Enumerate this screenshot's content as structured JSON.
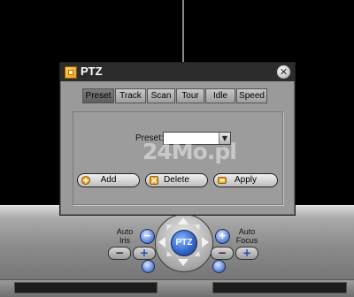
{
  "window": {
    "title": "PTZ",
    "close_icon": "close-icon",
    "icon": "ptz-app-icon"
  },
  "tabs": [
    {
      "label": "Preset",
      "active": true
    },
    {
      "label": "Track",
      "active": false
    },
    {
      "label": "Scan",
      "active": false
    },
    {
      "label": "Tour",
      "active": false
    },
    {
      "label": "Idle",
      "active": false
    },
    {
      "label": "Speed",
      "active": false
    }
  ],
  "preset": {
    "label": "Preset:",
    "value": "",
    "watermark": "24Mo.pl"
  },
  "actions": {
    "add": {
      "label": "Add",
      "icon": "add-icon"
    },
    "delete": {
      "label": "Delete",
      "icon": "delete-icon"
    },
    "apply": {
      "label": "Apply",
      "icon": "apply-icon"
    }
  },
  "controls": {
    "auto_iris": {
      "label_line1": "Auto",
      "label_line2": "Iris"
    },
    "auto_focus": {
      "label_line1": "Auto",
      "label_line2": "Focus"
    },
    "center_label": "PTZ",
    "minus": "−",
    "plus": "+"
  },
  "colors": {
    "titlebar": "#2c2c2c",
    "dialog_bg": "#9a9a9a",
    "ptz_center": "#2f62c8",
    "accent_orange": "#f09a1a"
  }
}
